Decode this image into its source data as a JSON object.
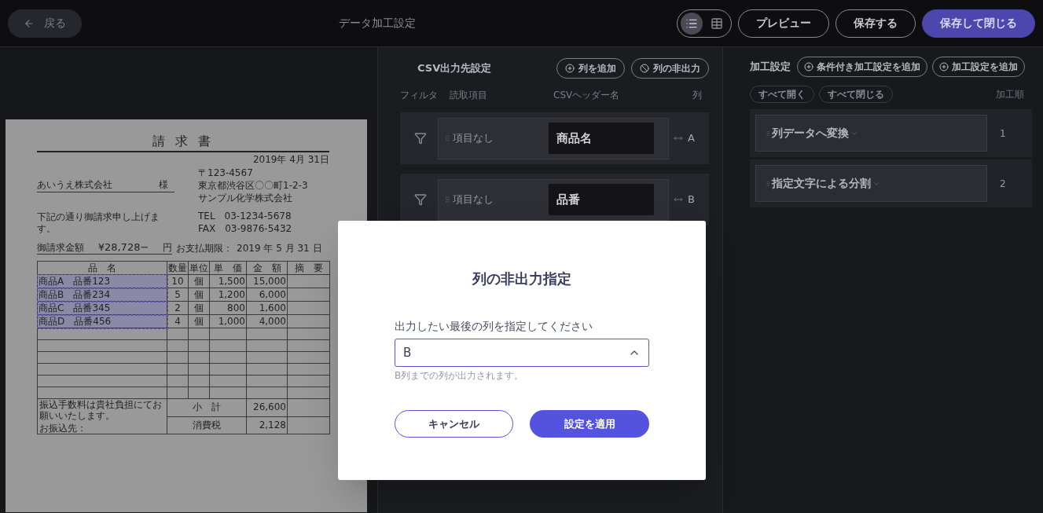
{
  "top_bar": {
    "back_button": "戻る",
    "title": "データ加工設定",
    "view_toggle": [
      {
        "kind": "list",
        "selected": true
      },
      {
        "kind": "grid",
        "selected": false
      }
    ],
    "buttons": [
      {
        "label": "プレビュー",
        "kind": "outline"
      },
      {
        "label": "保存する",
        "kind": "outline"
      },
      {
        "label": "保存して閉じる",
        "kind": "primary"
      }
    ]
  },
  "document": {
    "title": "請 求 書",
    "date": "2019年 4月 31日",
    "recipient": "あいうえ株式会社",
    "honorific": "様",
    "sender": [
      "〒123-4567",
      "東京都渋谷区〇〇町1-2-3",
      "サンプル化学株式会社"
    ],
    "contact": [
      "TEL　03-1234-5678",
      "FAX　03-9876-5432"
    ],
    "greeting": "下記の通り御請求申し上げます。",
    "amount_label": "御請求金額",
    "amount": "¥28,728−",
    "currency": "円",
    "due_label": "お支払期限：",
    "due_date": "2019 年 5 月 31 日",
    "table": {
      "columns": [
        "品　名",
        "数量",
        "単位",
        "単　価",
        "金　額",
        "摘　要"
      ],
      "rows": [
        {
          "cells": [
            "商品A　品番123",
            "10",
            "個",
            "1,500",
            "15,000"
          ],
          "highlighted": true
        },
        {
          "cells": [
            "商品B　品番234",
            "5",
            "個",
            "1,200",
            "6,000"
          ],
          "highlighted": true
        },
        {
          "cells": [
            "商品C　品番345",
            "2",
            "個",
            "800",
            "1,600"
          ],
          "highlighted": true
        },
        {
          "cells": [
            "商品D　品番456",
            "4",
            "個",
            "1,000",
            "4,000"
          ],
          "highlighted": true
        }
      ],
      "note": "振込手数料は貴社負担にてお願いいたします。",
      "bank_label": "お振込先：",
      "totals": [
        {
          "label": "小　計",
          "value": "26,600"
        },
        {
          "label": "消費税",
          "value": "2,128"
        }
      ]
    }
  },
  "csv_output": {
    "title": "CSV出力先設定",
    "buttons": [
      {
        "label": "列を追加",
        "kind": "add"
      },
      {
        "label": "列の非出力",
        "kind": "hide"
      }
    ],
    "columns": [
      "フィルタ",
      "読取項目",
      "CSVヘッダー名",
      "列"
    ],
    "rows": [
      {
        "read_item": "項目なし",
        "header": "商品名",
        "column": "A"
      },
      {
        "read_item": "項目なし",
        "header": "品番",
        "column": "B"
      }
    ]
  },
  "processing": {
    "title": "加工設定",
    "buttons": [
      {
        "label": "条件付き加工設定を追加",
        "kind": "add"
      },
      {
        "label": "加工設定を追加",
        "kind": "add"
      }
    ],
    "expand_all": "すべて開く",
    "collapse_all": "すべて閉じる",
    "order_label": "加工順",
    "steps": [
      {
        "name": "列データへ変換",
        "order": "1"
      },
      {
        "name": "指定文字による分割",
        "order": "2"
      }
    ]
  },
  "dialog": {
    "title": "列の非出力指定",
    "field_label": "出力したい最後の列を指定してください",
    "select": {
      "value": "B",
      "expanded": true
    },
    "hint": "B列までの列が出力されます。",
    "cancel": "キャンセル",
    "apply": "設定を適用"
  }
}
